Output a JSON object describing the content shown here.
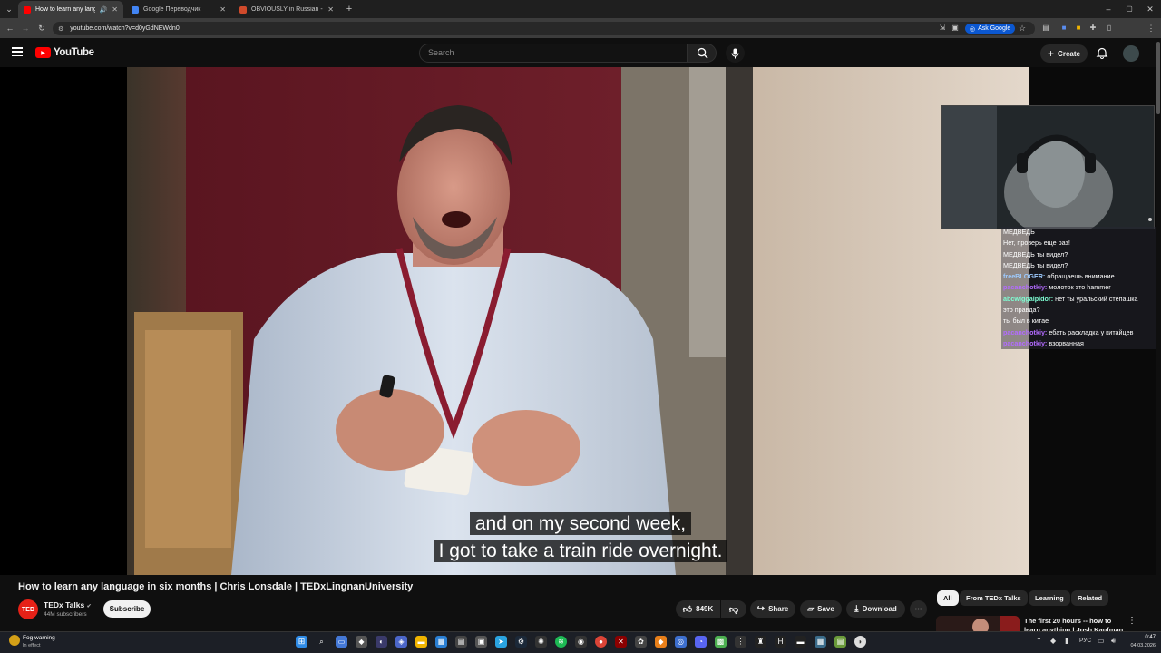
{
  "browser": {
    "tabs": [
      {
        "title": "How to learn any language",
        "fav_color": "#ff0000",
        "active": true
      },
      {
        "title": "Google Переводчик",
        "fav_color": "#4285f4",
        "active": false
      },
      {
        "title": "OBVIOUSLY in Russian - Cambr",
        "fav_color": "#d04a2b",
        "active": false
      }
    ],
    "url": "youtube.com/watch?v=d0yGdNEWdn0",
    "ask_google": "Ask Google"
  },
  "youtube": {
    "logo_text": "YouTube",
    "search_placeholder": "Search",
    "create_label": "Create"
  },
  "video": {
    "subtitle_line1": "and on my second week,",
    "subtitle_line2": "I got to take a train ride overnight.",
    "title": "How to learn any language in six months | Chris Lonsdale | TEDxLingnanUniversity"
  },
  "overlay_chat": [
    {
      "nick": "",
      "text": "МЕДВЕДЬ",
      "color": "#ff4d4d"
    },
    {
      "nick": "",
      "text": "Нет, проверь еще раз!",
      "color": "#ff4d4d"
    },
    {
      "nick": "",
      "text": "МЕДВЕДЬ ты видел?",
      "color": "#ff4d4d"
    },
    {
      "nick": "",
      "text": "МЕДВЕДЬ ты видел?",
      "color": "#ff4d4d"
    },
    {
      "nick": "freeBLOGER:",
      "text": " обращаешь внимание",
      "color": "#9ecbff"
    },
    {
      "nick": "pacanchotkiy:",
      "text": " молоток это hammer",
      "color": "#b36bff"
    },
    {
      "nick": "abcwiggalpidor:",
      "text": " нет ты уральский степашка",
      "color": "#7fffd4"
    },
    {
      "nick": "",
      "text": "это правда?",
      "color": "#ff4d4d"
    },
    {
      "nick": "",
      "text": "ты был в китае",
      "color": "#ff4d4d"
    },
    {
      "nick": "pacanchotkiy:",
      "text": " ебать раскладка у китайцев",
      "color": "#b36bff"
    },
    {
      "nick": "pacanchotkiy:",
      "text": " взорванная",
      "color": "#b36bff"
    }
  ],
  "channel": {
    "avatar_text": "TED",
    "name": "TEDx Talks",
    "subscribers": "44M subscribers",
    "subscribe_label": "Subscribe"
  },
  "actions": {
    "likes": "849K",
    "share": "Share",
    "save": "Save",
    "download": "Download"
  },
  "chips": [
    "All",
    "From TEDx Talks",
    "Learning",
    "Related"
  ],
  "recommendation": {
    "title": "The first 20 hours -- how to learn anything | Josh Kaufman"
  },
  "taskbar": {
    "weather_title": "Fog warning",
    "weather_sub": "In effect",
    "lang": "РУС",
    "time": "0:47",
    "date": "04.03.2026"
  },
  "colors": {
    "accent_red": "#ff0000",
    "background": "#0f0f0f"
  }
}
